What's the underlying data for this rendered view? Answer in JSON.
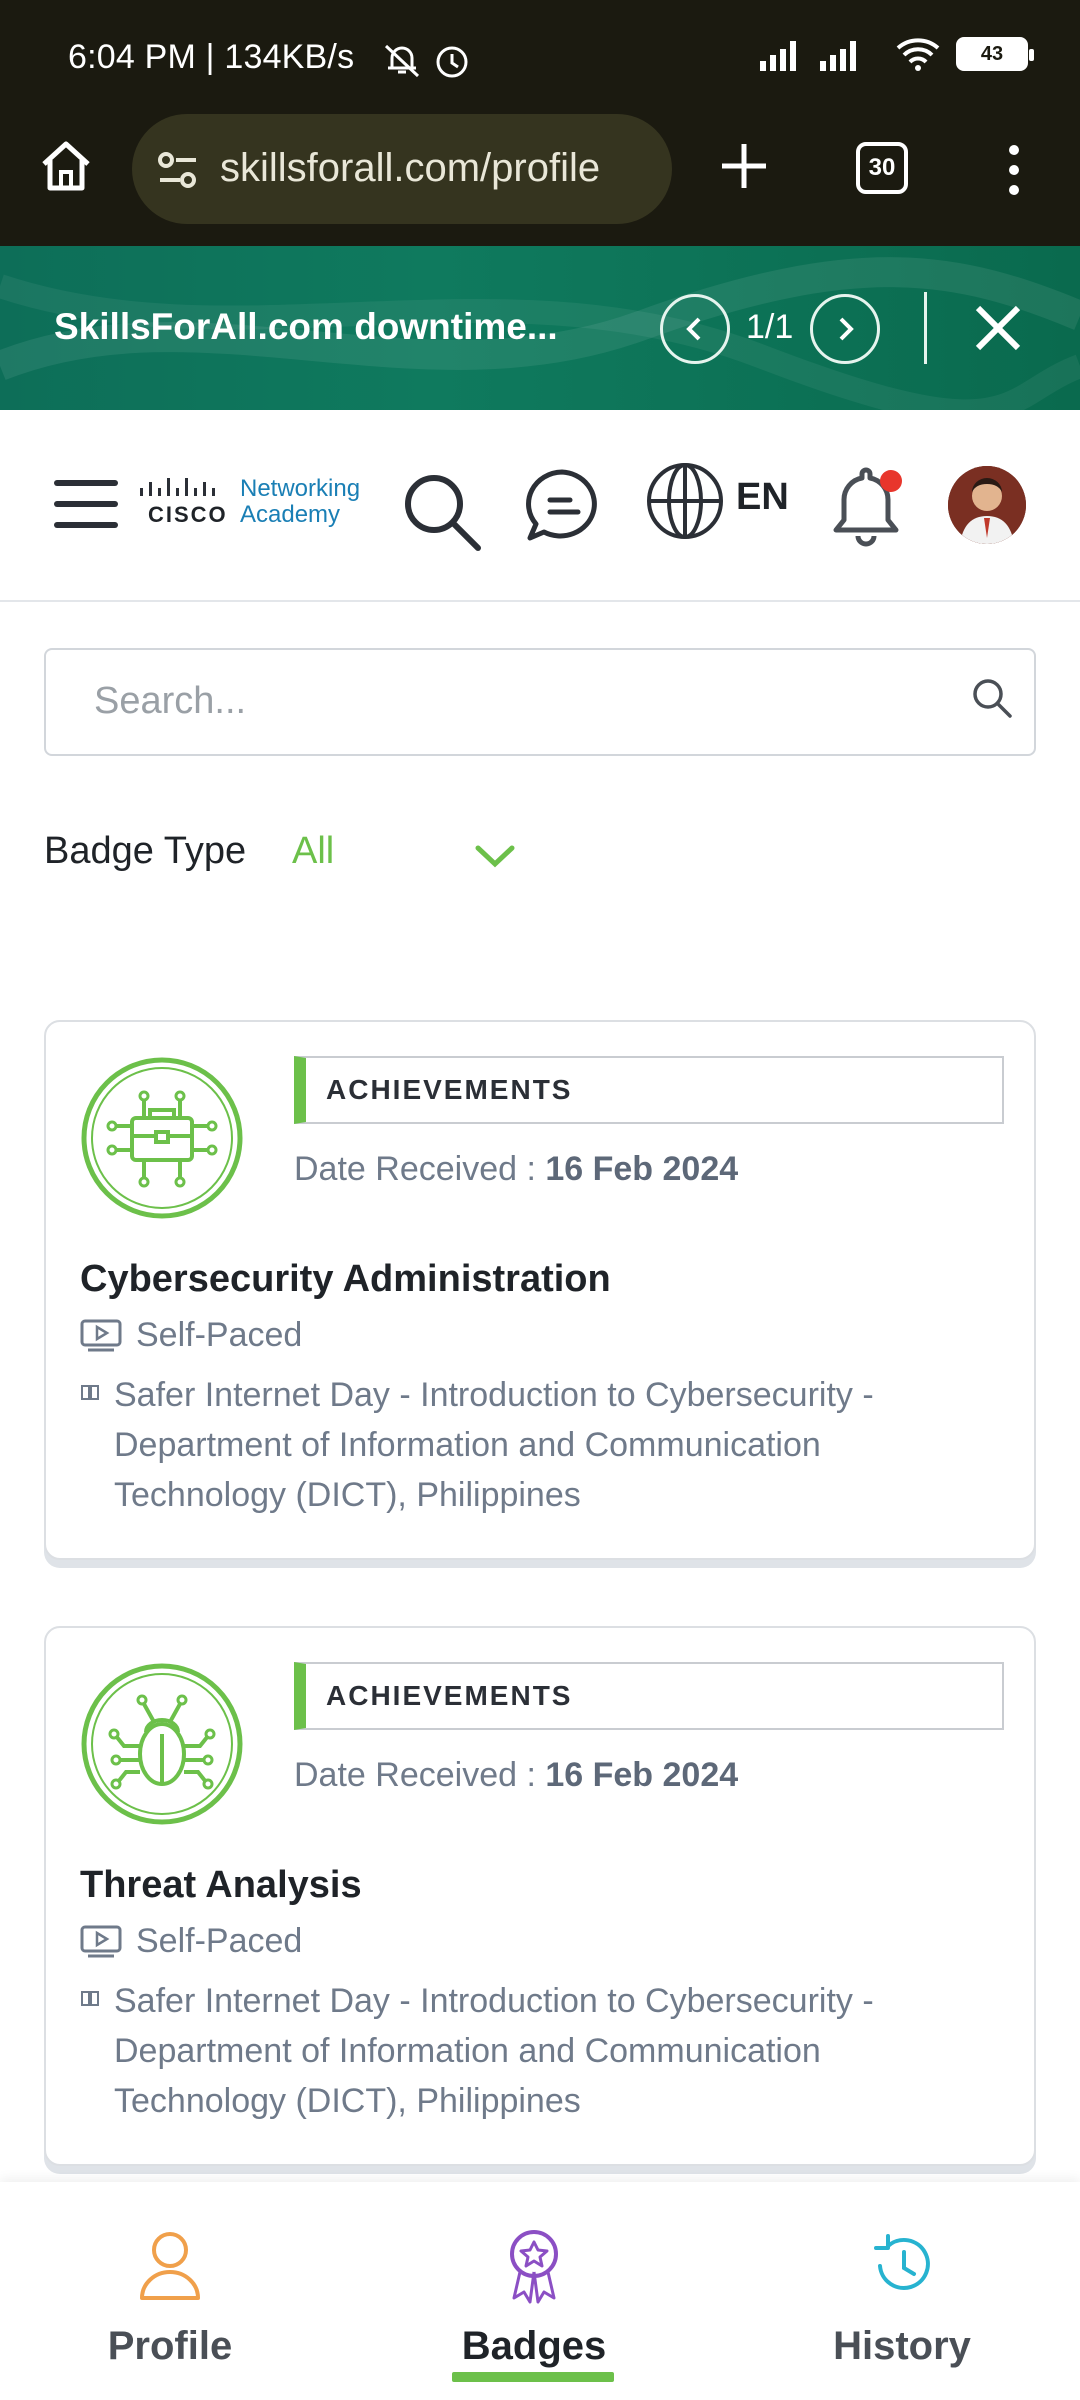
{
  "status_bar": {
    "time_speed": "6:04 PM | 134KB/s",
    "battery": "43"
  },
  "browser": {
    "url": "skillsforall.com/profile",
    "tab_count": "30"
  },
  "banner": {
    "text": "SkillsForAll.com downtime...",
    "counter": "1/1"
  },
  "header": {
    "logo_brand": "CISCO",
    "logo_line1": "Networking",
    "logo_line2": "Academy",
    "language": "EN"
  },
  "search": {
    "placeholder": "Search..."
  },
  "filter": {
    "label": "Badge Type",
    "value": "All"
  },
  "badges": [
    {
      "category": "ACHIEVEMENTS",
      "date_label": "Date Received : ",
      "date": "16 Feb 2024",
      "title": "Cybersecurity Administration",
      "pace": "Self-Paced",
      "course": "Safer Internet Day - Introduction to Cybersecurity - Department of Information and Communication Technology (DICT), Philippines",
      "icon": "briefcase-circuit-icon"
    },
    {
      "category": "ACHIEVEMENTS",
      "date_label": "Date Received : ",
      "date": "16 Feb 2024",
      "title": "Threat Analysis",
      "pace": "Self-Paced",
      "course": "Safer Internet Day - Introduction to Cybersecurity - Department of Information and Communication Technology (DICT), Philippines",
      "icon": "bug-icon"
    }
  ],
  "bottom_nav": {
    "items": [
      {
        "label": "Profile",
        "icon": "person-icon"
      },
      {
        "label": "Badges",
        "icon": "badge-icon",
        "active": true
      },
      {
        "label": "History",
        "icon": "history-icon"
      }
    ]
  },
  "colors": {
    "accent_green": "#6cc04a",
    "banner_teal": "#0d6e58",
    "chrome_dark": "#1b1a10",
    "notification_red": "#e8362c"
  }
}
